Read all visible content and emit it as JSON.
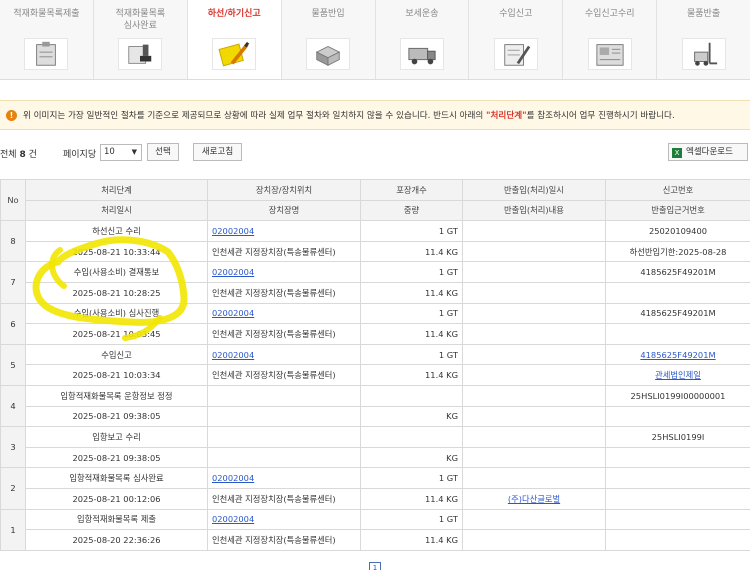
{
  "steps": [
    {
      "label": "적재화물목록제출",
      "icon": "clipboard-icon"
    },
    {
      "label": "적재화물목록\n심사완료",
      "icon": "stamp-icon"
    },
    {
      "label": "하선/하기신고",
      "icon": "clipboard-pencil-icon",
      "active": true
    },
    {
      "label": "물품반입",
      "icon": "boxes-icon"
    },
    {
      "label": "보세운송",
      "icon": "truck-icon"
    },
    {
      "label": "수입신고",
      "icon": "document-pen-icon"
    },
    {
      "label": "수입신고수리",
      "icon": "form-check-icon"
    },
    {
      "label": "물품반출",
      "icon": "forklift-icon"
    }
  ],
  "notice": {
    "before": "위 이미지는 가장 일반적인 절차를 기준으로 제공되므로 상황에 따라 실제 업무 절차와 일치하지 않을 수 있습니다. 반드시 아래의 ",
    "highlight": "\"처리단계\"",
    "after": "를 참조하시어 업무 진행하시기 바랍니다."
  },
  "toolbar": {
    "total_prefix": "전체",
    "total_count": "8",
    "total_suffix": "건",
    "per_page_label": "페이지당",
    "per_page_value": "10",
    "select_button": "선택",
    "refresh_button": "새로고침",
    "excel_button": "엑셀다운로드"
  },
  "table": {
    "headers": {
      "no": "No",
      "row1": [
        "처리단계",
        "장치장/장치위치",
        "포장개수",
        "반출입(처리)일시",
        "신고번호"
      ],
      "row2": [
        "처리일시",
        "장치장명",
        "중량",
        "반출입(처리)내용",
        "반출입근거번호"
      ]
    },
    "rows": [
      {
        "no": "8",
        "step": "하선신고 수리",
        "datetime": "2025-08-21 10:33:44",
        "location": "02002004",
        "location_name": "인천세관 지정장치장(특송물류센터)",
        "pkg": "1 GT",
        "weight": "11.4 KG",
        "io_time": "",
        "io_content": "",
        "report_no": "25020109400",
        "basis_no": "하선반입기한:2025-08-28",
        "report_link": false,
        "basis_link": false
      },
      {
        "no": "7",
        "step": "수입(사용소비) 결재통보",
        "datetime": "2025-08-21 10:28:25",
        "location": "02002004",
        "location_name": "인천세관 지정장치장(특송물류센터)",
        "pkg": "1 GT",
        "weight": "11.4 KG",
        "io_time": "",
        "io_content": "",
        "report_no": "4185625F49201M",
        "basis_no": "",
        "report_link": false,
        "basis_link": false
      },
      {
        "no": "6",
        "step": "수입(사용소비) 심사진행",
        "datetime": "2025-08-21 10:03:45",
        "location": "02002004",
        "location_name": "인천세관 지정장치장(특송물류센터)",
        "pkg": "1 GT",
        "weight": "11.4 KG",
        "io_time": "",
        "io_content": "",
        "report_no": "4185625F49201M",
        "basis_no": "",
        "report_link": false,
        "basis_link": false
      },
      {
        "no": "5",
        "step": "수입신고",
        "datetime": "2025-08-21 10:03:34",
        "location": "02002004",
        "location_name": "인천세관 지정장치장(특송물류센터)",
        "pkg": "1 GT",
        "weight": "11.4 KG",
        "io_time": "",
        "io_content": "",
        "report_no": "4185625F49201M",
        "basis_no": "관세법인제일",
        "report_link": true,
        "basis_link": true
      },
      {
        "no": "4",
        "step": "입항적재화물목록 운항정보 정정",
        "datetime": "2025-08-21 09:38:05",
        "location": "",
        "location_name": "",
        "pkg": "",
        "weight": "KG",
        "io_time": "",
        "io_content": "",
        "report_no": "25HSLI0199I00000001",
        "basis_no": "",
        "report_link": false,
        "basis_link": false
      },
      {
        "no": "3",
        "step": "입항보고 수리",
        "datetime": "2025-08-21 09:38:05",
        "location": "",
        "location_name": "",
        "pkg": "",
        "weight": "KG",
        "io_time": "",
        "io_content": "",
        "report_no": "25HSLI0199I",
        "basis_no": "",
        "report_link": false,
        "basis_link": false
      },
      {
        "no": "2",
        "step": "입항적재화물목록 심사완료",
        "datetime": "2025-08-21 00:12:06",
        "location": "02002004",
        "location_name": "인천세관 지정장치장(특송물류센터)",
        "pkg": "1 GT",
        "weight": "11.4 KG",
        "io_time": "",
        "io_content": "(주)다산글로벌",
        "report_no": "",
        "basis_no": "",
        "report_link": false,
        "basis_link": false
      },
      {
        "no": "1",
        "step": "입항적재화물목록 제출",
        "datetime": "2025-08-20 22:36:26",
        "location": "02002004",
        "location_name": "인천세관 지정장치장(특송물류센터)",
        "pkg": "1 GT",
        "weight": "11.4 KG",
        "io_time": "",
        "io_content": "",
        "report_no": "",
        "basis_no": "",
        "report_link": false,
        "basis_link": false
      }
    ]
  },
  "pager": {
    "current": "1"
  },
  "colors": {
    "accent_red": "#d9342b",
    "link_blue": "#2a57c9",
    "highlight_yellow": "#f2e600",
    "notice_bg": "#fff8e6"
  }
}
